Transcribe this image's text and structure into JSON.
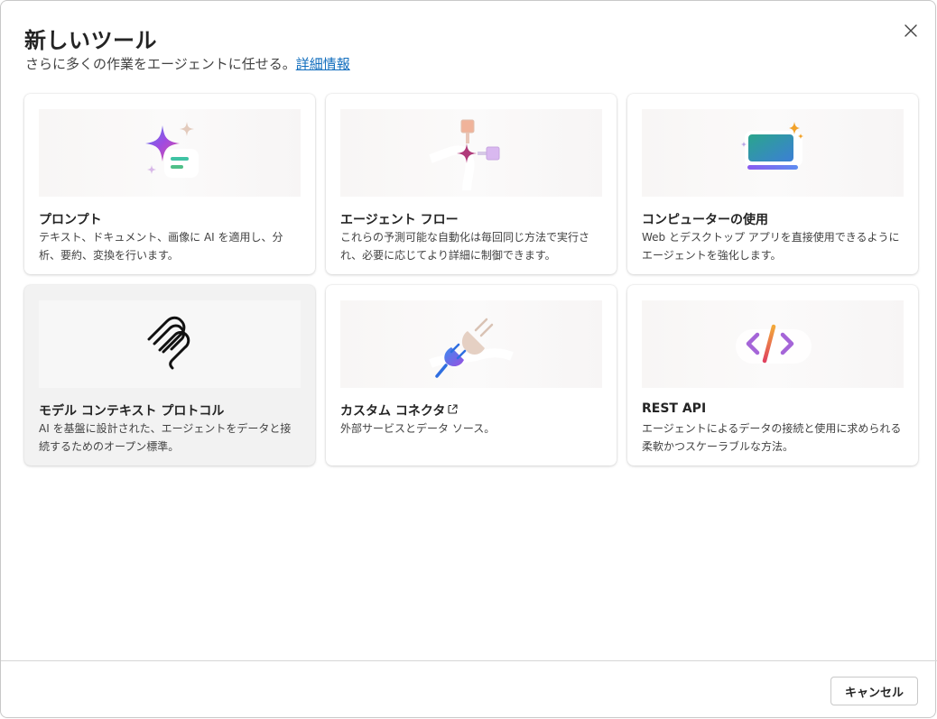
{
  "dialog": {
    "title": "新しいツール",
    "subtitle": "さらに多くの作業をエージェントに任せる。",
    "learn_more": "詳細情報",
    "close_icon": "close-icon"
  },
  "cards": [
    {
      "title": "プロンプト",
      "description": "テキスト、ドキュメント、画像に AI を適用し、分析、要約、変換を行います。",
      "icon": "prompt-sparkle-icon"
    },
    {
      "title": "エージェント フロー",
      "description": "これらの予測可能な自動化は毎回同じ方法で実行され、必要に応じてより詳細に制御できます。",
      "icon": "agent-flow-icon"
    },
    {
      "title": "コンピューターの使用",
      "description": "Web とデスクトップ アプリを直接使用できるようにエージェントを強化します。",
      "icon": "computer-use-icon"
    },
    {
      "title": "モデル コンテキスト プロトコル",
      "description": "AI を基盤に設計された、エージェントをデータと接続するためのオープン標準。",
      "icon": "mcp-icon"
    },
    {
      "title": "カスタム コネクタ",
      "description": "外部サービスとデータ ソース。",
      "icon": "plug-connector-icon",
      "external_icon": "external-link-icon"
    },
    {
      "title": "REST API",
      "description": "エージェントによるデータの接続と使用に求められる柔軟かつスケーラブルな方法。",
      "icon": "code-brackets-icon"
    }
  ],
  "footer": {
    "cancel_label": "キャンセル"
  }
}
